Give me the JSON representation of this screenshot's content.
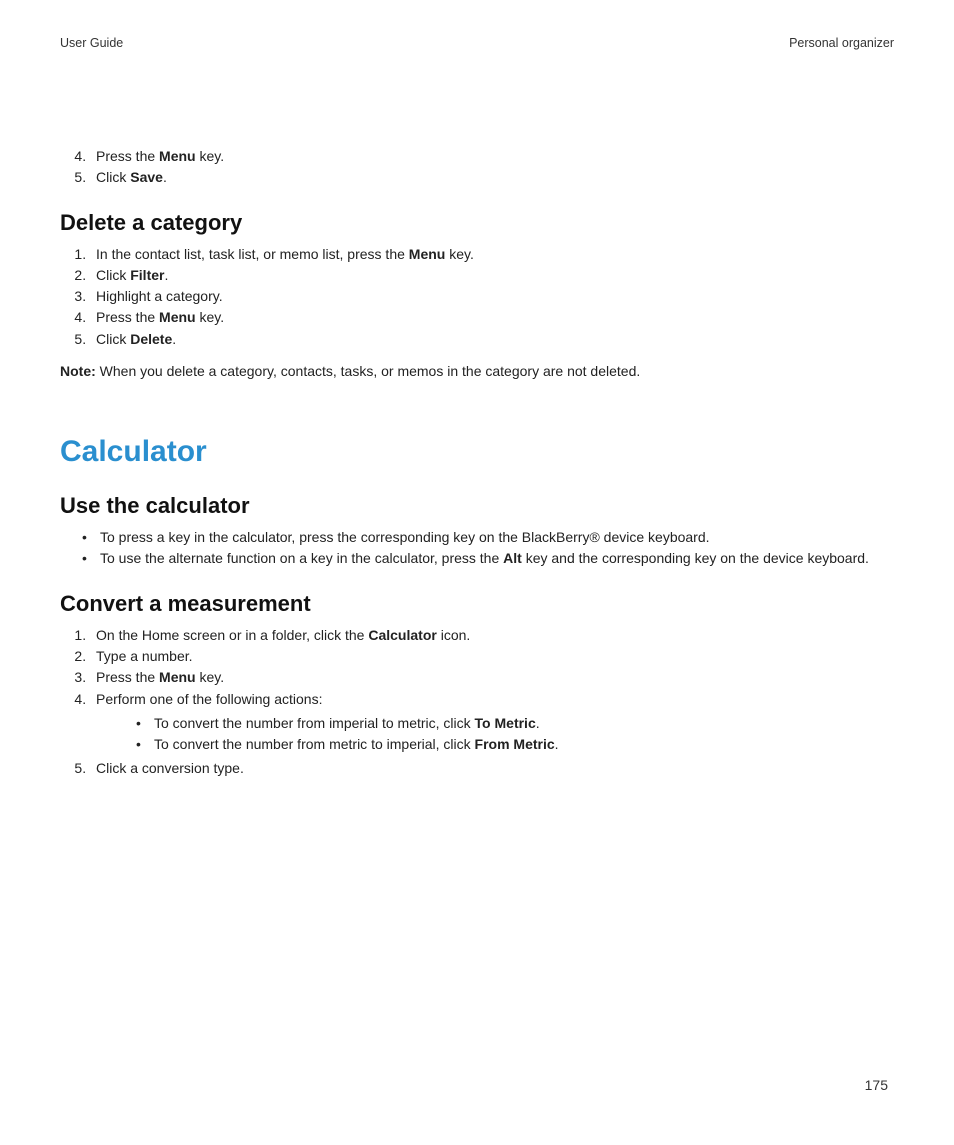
{
  "header": {
    "left": "User Guide",
    "right": "Personal organizer"
  },
  "intro_steps": {
    "start": 4,
    "items": [
      {
        "pre": "Press the ",
        "bold": "Menu",
        "post": " key."
      },
      {
        "pre": "Click ",
        "bold": "Save",
        "post": "."
      }
    ]
  },
  "delete_category": {
    "heading": "Delete a category",
    "steps": [
      {
        "pre": "In the contact list, task list, or memo list, press the ",
        "bold": "Menu",
        "post": " key."
      },
      {
        "pre": "Click ",
        "bold": "Filter",
        "post": "."
      },
      {
        "pre": "Highlight a category.",
        "bold": "",
        "post": ""
      },
      {
        "pre": "Press the ",
        "bold": "Menu",
        "post": " key."
      },
      {
        "pre": "Click ",
        "bold": "Delete",
        "post": "."
      }
    ],
    "note_label": "Note:",
    "note_text": "  When you delete a category, contacts, tasks, or memos in the category are not deleted."
  },
  "calculator": {
    "chapter": "Calculator",
    "use_heading": "Use the calculator",
    "use_bullets": [
      {
        "pre": "To press a key in the calculator, press the corresponding key on the BlackBerry® device keyboard.",
        "bold": "",
        "post": ""
      },
      {
        "pre": "To use the alternate function on a key in the calculator, press the ",
        "bold": "Alt",
        "post": " key and the corresponding key on the device keyboard."
      }
    ],
    "convert_heading": "Convert a measurement",
    "convert_steps": [
      {
        "pre": "On the Home screen or in a folder, click the ",
        "bold": "Calculator",
        "post": " icon."
      },
      {
        "pre": "Type a number.",
        "bold": "",
        "post": ""
      },
      {
        "pre": "Press the ",
        "bold": "Menu",
        "post": " key."
      },
      {
        "pre": "Perform one of the following actions:",
        "bold": "",
        "post": ""
      }
    ],
    "convert_sub": [
      {
        "pre": "To convert the number from imperial to metric, click ",
        "bold": "To Metric",
        "post": "."
      },
      {
        "pre": "To convert the number from metric to imperial, click ",
        "bold": "From Metric",
        "post": "."
      }
    ],
    "convert_tail": [
      {
        "pre": "Click a conversion type.",
        "bold": "",
        "post": ""
      }
    ],
    "convert_tail_start": 5
  },
  "page_number": "175"
}
